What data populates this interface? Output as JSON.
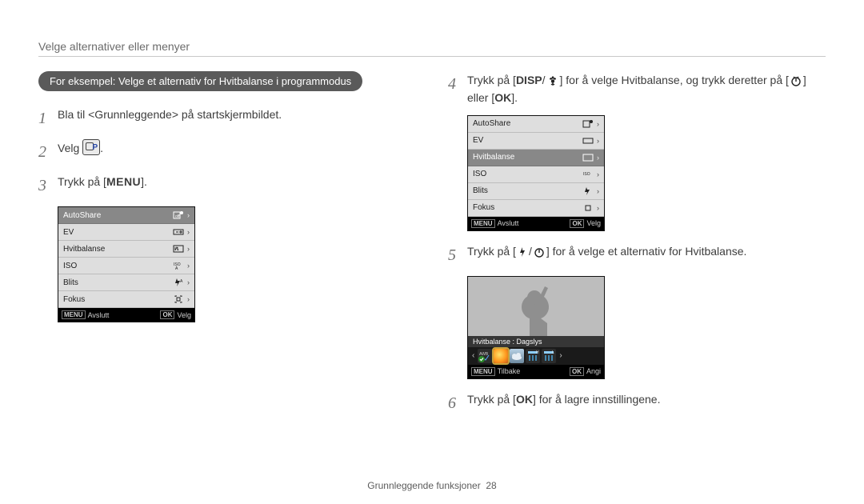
{
  "page": {
    "title": "Velge alternativer eller menyer",
    "footer_chapter": "Grunnleggende funksjoner",
    "footer_page": "28"
  },
  "left": {
    "callout": "For eksempel: Velge et alternativ for Hvitbalanse i programmodus",
    "steps": {
      "s1": "Bla til <Grunnleggende> på startskjermbildet.",
      "s2_pre": "Velg ",
      "s2_post": ".",
      "s3_pre": "Trykk på [",
      "s3_menu": "MENU",
      "s3_post": "]."
    }
  },
  "right": {
    "steps": {
      "s4_pre": "Trykk på [",
      "s4_disp": "DISP",
      "s4_mid1": "/",
      "s4_mid2": "] for å velge Hvitbalanse, og trykk deretter på [",
      "s4_mid3": "] eller [",
      "s4_ok": "OK",
      "s4_post": "].",
      "s5_pre": "Trykk på [",
      "s5_mid1": "/",
      "s5_post": "] for å velge et alternativ for Hvitbalanse.",
      "s6_pre": "Trykk på [",
      "s6_ok": "OK",
      "s6_post": "] for å lagre innstillingene."
    }
  },
  "menu_items": {
    "autoshare": "AutoShare",
    "ev": "EV",
    "hvitbalanse": "Hvitbalanse",
    "iso": "ISO",
    "blits": "Blits",
    "fokus": "Fokus"
  },
  "lcd_footer": {
    "menu": "MENU",
    "exit": "Avslutt",
    "ok": "OK",
    "select": "Velg",
    "back": "Tilbake",
    "set": "Angi"
  },
  "preview": {
    "label_full": "Hvitbalanse : Dagslys"
  }
}
